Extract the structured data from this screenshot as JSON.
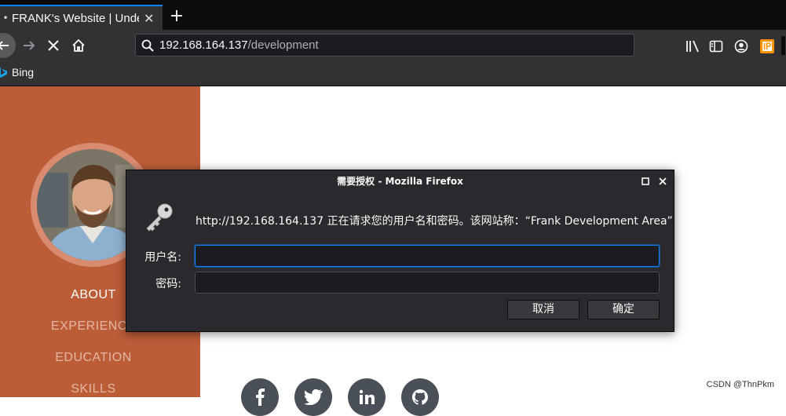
{
  "browser": {
    "tab_title": "FRANK's Website | Unde",
    "url_host": "192.168.164.137",
    "url_path": "/development",
    "bookmark_label": "Bing"
  },
  "sidebar": {
    "nav": [
      "ABOUT",
      "EXPERIENCE",
      "EDUCATION",
      "SKILLS"
    ]
  },
  "dialog": {
    "title": "需要授权 - Mozilla Firefox",
    "message": "http://192.168.164.137 正在请求您的用户名和密码。该网站称：“Frank Development Area”",
    "username_label": "用户名:",
    "password_label": "密码:",
    "username_value": "",
    "password_value": "",
    "cancel_label": "取消",
    "ok_label": "确定"
  },
  "watermark": "CSDN @ThnPkm",
  "colors": {
    "sidebar": "#bd5d38",
    "accent": "#0a84ff"
  }
}
